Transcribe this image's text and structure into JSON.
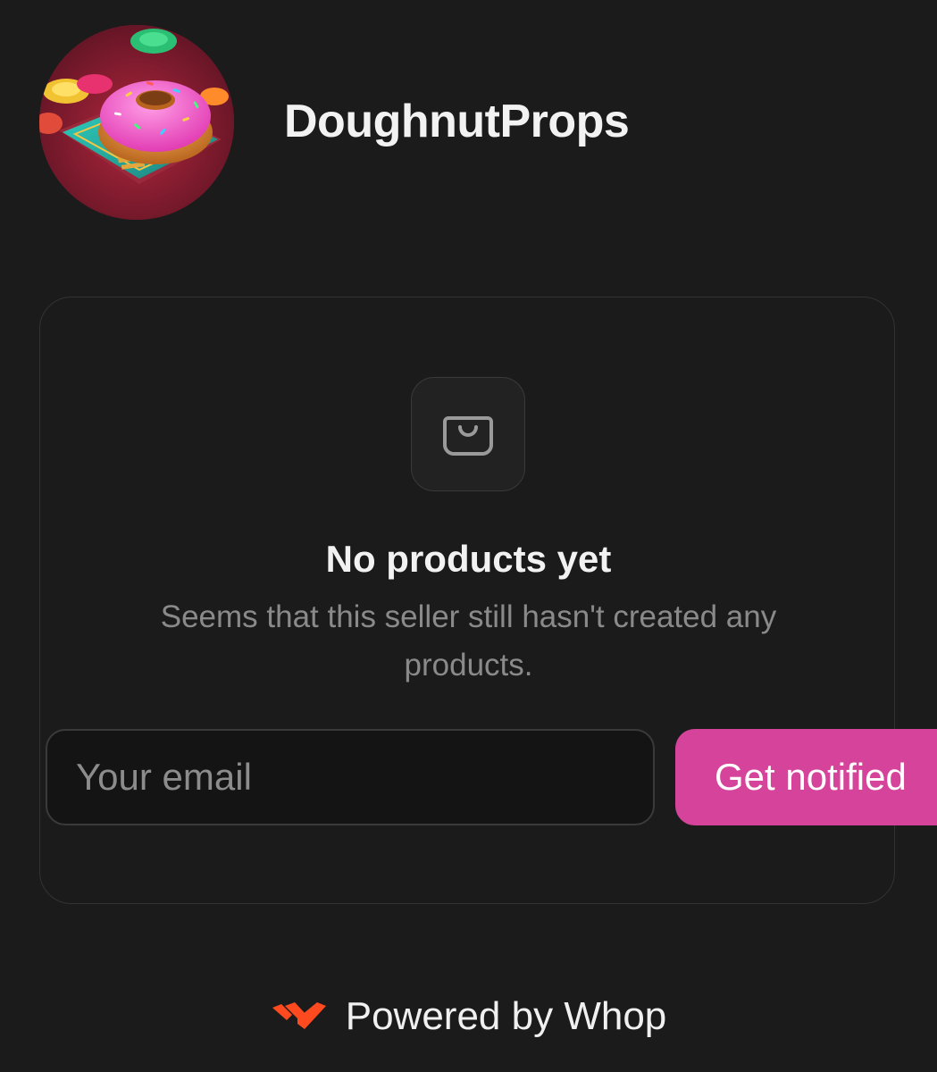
{
  "store": {
    "name": "DoughnutProps",
    "avatar_icon": "doughnut-logo-icon"
  },
  "empty_state": {
    "icon": "shopping-bag-icon",
    "title": "No products yet",
    "description": "Seems that this seller still hasn't created any products."
  },
  "notify_form": {
    "email_value": "",
    "email_placeholder": "Your email",
    "button_label": "Get notified"
  },
  "footer": {
    "logo_icon": "whop-logo-icon",
    "text": "Powered by Whop"
  },
  "colors": {
    "background": "#1b1b1b",
    "accent": "#d5449a",
    "whop_brand": "#ff4a1f"
  }
}
